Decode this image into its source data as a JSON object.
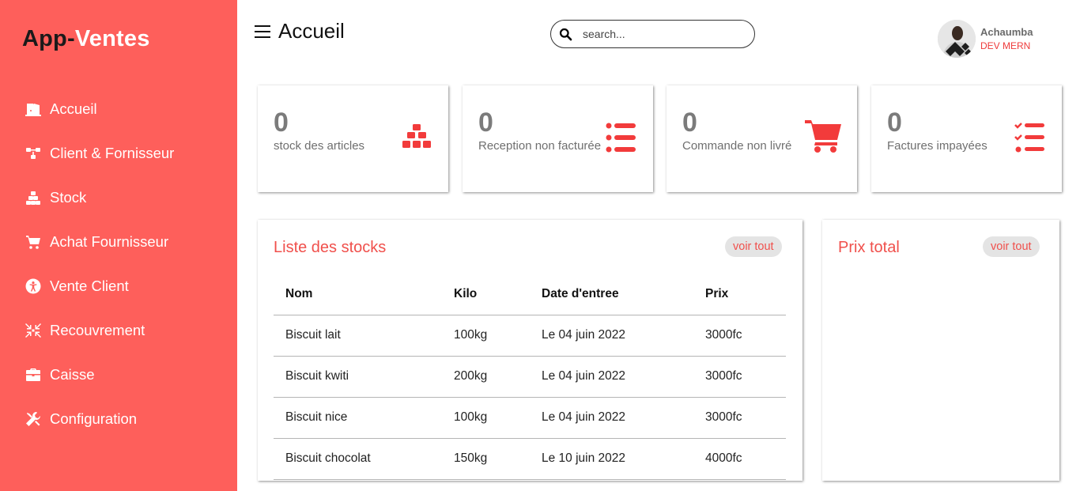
{
  "brand": {
    "part1": "App-",
    "part2": "Ventes"
  },
  "sidebar": {
    "items": [
      {
        "label": "Accueil",
        "icon": "door-open-icon"
      },
      {
        "label": "Client & Fornisseur",
        "icon": "network-icon"
      },
      {
        "label": "Stock",
        "icon": "boxes-icon"
      },
      {
        "label": "Achat Fournisseur",
        "icon": "cart-icon"
      },
      {
        "label": "Vente Client",
        "icon": "accessibility-icon"
      },
      {
        "label": "Recouvrement",
        "icon": "arrows-collapse-icon"
      },
      {
        "label": "Caisse",
        "icon": "briefcase-icon"
      },
      {
        "label": "Configuration",
        "icon": "tools-icon"
      }
    ]
  },
  "header": {
    "title": "Accueil",
    "search_placeholder": "search...",
    "user_name": "Achaumba",
    "user_role": "DEV MERN"
  },
  "cards": [
    {
      "value": "0",
      "label": "stock des articles",
      "icon": "boxes-icon"
    },
    {
      "value": "0",
      "label": "Reception non facturée",
      "icon": "list-icon"
    },
    {
      "value": "0",
      "label": "Commande non livré",
      "icon": "cart-icon"
    },
    {
      "value": "0",
      "label": "Factures impayées",
      "icon": "checklist-icon"
    }
  ],
  "stocks": {
    "title": "Liste des stocks",
    "voir_tout": "voir tout",
    "columns": [
      "Nom",
      "Kilo",
      "Date d'entree",
      "Prix"
    ],
    "rows": [
      [
        "Biscuit lait",
        "100kg",
        "Le 04 juin 2022",
        "3000fc"
      ],
      [
        "Biscuit kwiti",
        "200kg",
        "Le 04 juin 2022",
        "3000fc"
      ],
      [
        "Biscuit nice",
        "100kg",
        "Le 04 juin 2022",
        "3000fc"
      ],
      [
        "Biscuit chocolat",
        "150kg",
        "Le 10 juin 2022",
        "4000fc"
      ]
    ]
  },
  "prix": {
    "title": "Prix total",
    "voir_tout": "voir tout"
  },
  "colors": {
    "sidebar": "#fe5f5b",
    "accent": "#f23b3b",
    "brand_dark": "#1a1a1a"
  }
}
